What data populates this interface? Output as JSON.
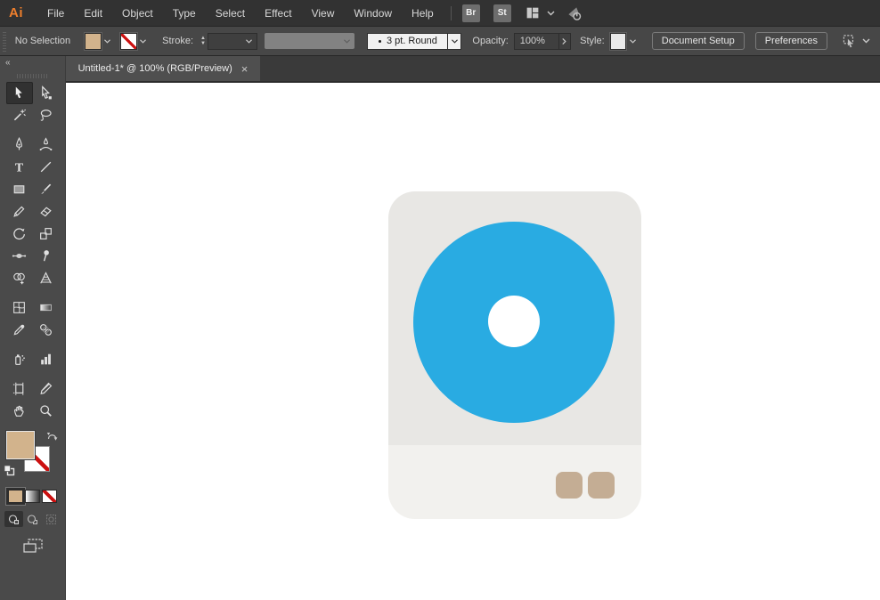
{
  "app": {
    "logo_text": "Ai"
  },
  "menubar": {
    "menus": [
      "File",
      "Edit",
      "Object",
      "Type",
      "Select",
      "Effect",
      "View",
      "Window",
      "Help"
    ],
    "bridge_label": "Br",
    "stock_label": "St"
  },
  "controlbar": {
    "selection_status": "No Selection",
    "fill_color": "#d2b38c",
    "stroke_label": "Stroke:",
    "brush_value": "3 pt. Round",
    "opacity_label": "Opacity:",
    "opacity_value": "100%",
    "style_label": "Style:",
    "document_setup_label": "Document Setup",
    "preferences_label": "Preferences"
  },
  "tabbar": {
    "tab_title": "Untitled-1* @ 100% (RGB/Preview)",
    "close_glyph": "×"
  },
  "toolbar": {
    "collapse_glyph": "«",
    "selected_tool": "selection",
    "tools": [
      "selection",
      "direct-selection",
      "magic-wand",
      "lasso",
      "pen",
      "curvature",
      "type",
      "line-segment",
      "rectangle",
      "paintbrush",
      "shaper",
      "eraser",
      "rotate",
      "scale",
      "width",
      "puppet-warp",
      "shape-builder",
      "perspective-grid",
      "mesh",
      "gradient",
      "eyedropper",
      "blend",
      "symbol-sprayer",
      "column-graph",
      "artboard",
      "slice",
      "hand",
      "zoom"
    ],
    "fill_color": "#d2b38c"
  },
  "artwork": {
    "card_top_color": "#e8e7e4",
    "card_bottom_color": "#f2f1ee",
    "disc_color": "#29abe2",
    "hole_color": "#ffffff",
    "button_color": "#c4ad94"
  }
}
